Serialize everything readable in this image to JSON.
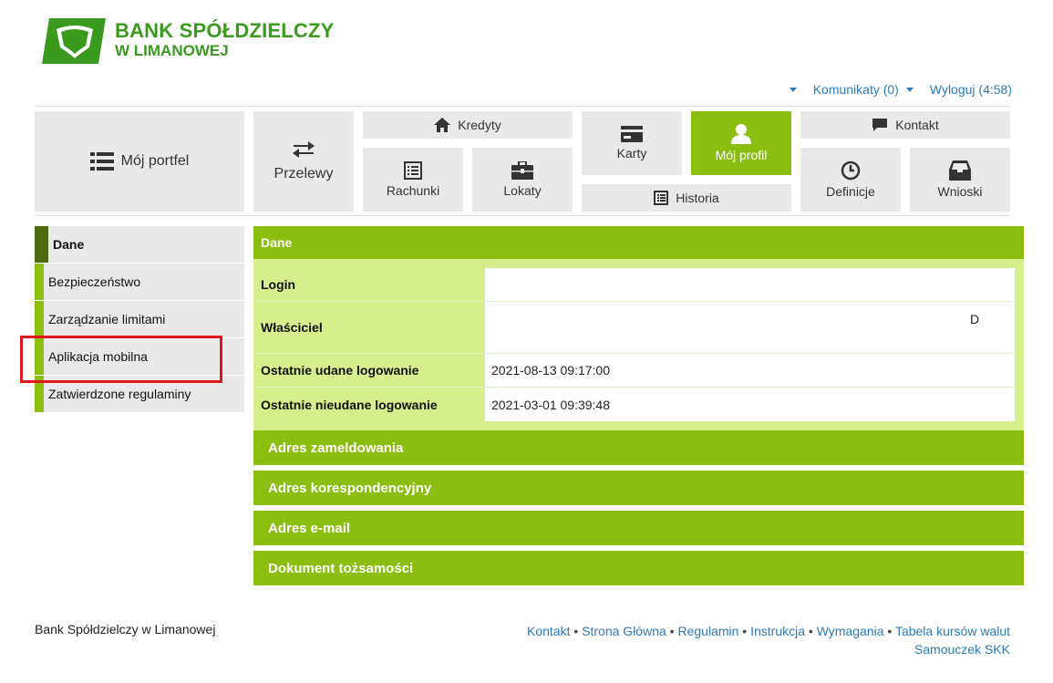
{
  "brand": {
    "line1": "BANK SPÓŁDZIELCZY",
    "line2": "W LIMANOWEJ",
    "color": "#3a9a1e"
  },
  "util": {
    "messages_label": "Komunikaty (0)",
    "logout_label": "Wyloguj (4:58)"
  },
  "nav": {
    "portfolio": "Mój portfel",
    "transfers": "Przelewy",
    "credits": "Kredyty",
    "accounts": "Rachunki",
    "deposits": "Lokaty",
    "cards": "Karty",
    "history": "Historia",
    "profile": "Mój profil",
    "contact": "Kontakt",
    "definitions": "Definicje",
    "applications": "Wnioski"
  },
  "sidebar": {
    "items": [
      {
        "label": "Dane"
      },
      {
        "label": "Bezpieczeństwo"
      },
      {
        "label": "Zarządzanie limitami"
      },
      {
        "label": "Aplikacja mobilna"
      },
      {
        "label": "Zatwierdzone regulaminy"
      }
    ]
  },
  "panel": {
    "title": "Dane",
    "rows": [
      {
        "key": "Login",
        "value": ""
      },
      {
        "key": "Właściciel",
        "value": "D"
      },
      {
        "key": "Ostatnie udane logowanie",
        "value": "2021-08-13 09:17:00"
      },
      {
        "key": "Ostatnie nieudane logowanie",
        "value": "2021-03-01 09:39:48"
      }
    ],
    "sections": [
      "Adres zameldowania",
      "Adres korespondencyjny",
      "Adres e-mail",
      "Dokument tożsamości"
    ]
  },
  "footer": {
    "bank_name": "Bank Spółdzielczy w Limanowej",
    "links": [
      "Kontakt",
      "Strona Główna",
      "Regulamin",
      "Instrukcja",
      "Wymagania",
      "Tabela kursów walut",
      "Samouczek SKK"
    ]
  },
  "colors": {
    "accent": "#8cbe12",
    "accent_dark": "#4d6a10",
    "panel_light": "#d6ee8c",
    "link": "#2b7bb9",
    "highlight": "#e3141b"
  }
}
